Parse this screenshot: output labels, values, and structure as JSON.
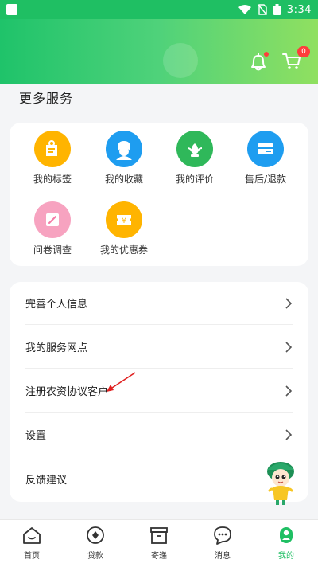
{
  "status_bar": {
    "time": "3:34"
  },
  "header": {
    "cart_count": "0",
    "accent": "#1fbf63"
  },
  "section_title": "更多服务",
  "services": [
    {
      "label": "我的标签",
      "icon": "tag-icon",
      "color": "#ffb400"
    },
    {
      "label": "我的收藏",
      "icon": "favorite-user-icon",
      "color": "#1e9df0"
    },
    {
      "label": "我的评价",
      "icon": "review-leaf-icon",
      "color": "#2fb85a"
    },
    {
      "label": "售后/退款",
      "icon": "refund-icon",
      "color": "#1e9df0"
    },
    {
      "label": "问卷调查",
      "icon": "survey-icon",
      "color": "#f47ba6"
    },
    {
      "label": "我的优惠券",
      "icon": "coupon-icon",
      "color": "#ffb400"
    }
  ],
  "menu": [
    {
      "label": "完善个人信息"
    },
    {
      "label": "我的服务网点"
    },
    {
      "label": "注册农资协议客户"
    },
    {
      "label": "设置"
    },
    {
      "label": "反馈建议"
    }
  ],
  "bottom_nav": [
    {
      "label": "首页",
      "icon": "home-icon"
    },
    {
      "label": "贷款",
      "icon": "loan-icon"
    },
    {
      "label": "寄递",
      "icon": "delivery-icon"
    },
    {
      "label": "消息",
      "icon": "message-icon"
    },
    {
      "label": "我的",
      "icon": "profile-icon",
      "active": true
    }
  ]
}
